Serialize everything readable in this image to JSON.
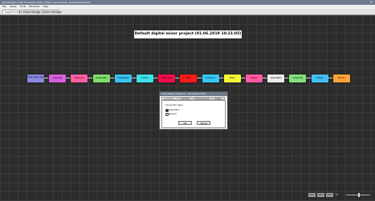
{
  "window": {
    "title": "Distributed Audio Processor Suite - Mixer Core Version 10 (Release Build)",
    "close": "✕"
  },
  "menu": [
    "File",
    "Setup",
    "Tools",
    "Windows",
    "Help"
  ],
  "tabs": [
    {
      "label": "Layout Control",
      "active": true
    },
    {
      "label": "Preset Manager",
      "active": false
    },
    {
      "label": "System Manager",
      "active": false
    }
  ],
  "project_title": "Default digital mixer project (01.06.2019 10:21:05)",
  "nodes": [
    {
      "label": "Input / Gain Adjust",
      "color": "#8a8adf"
    },
    {
      "label": "Insert EQ",
      "color": "#d65fe0"
    },
    {
      "label": "Dynamics",
      "color": "#ff5fa0"
    },
    {
      "label": "Noise Gate",
      "color": "#7ddd6d"
    },
    {
      "label": "Compressor",
      "color": "#39c2ef"
    },
    {
      "label": "Limiter",
      "color": "#3fe0e6"
    },
    {
      "label": "Delay Line",
      "color": "#f40d4d"
    },
    {
      "label": "Mute",
      "color": "#ff1a1a"
    },
    {
      "label": "Crossover",
      "color": "#38c6f6"
    },
    {
      "label": "Mixer",
      "color": "#f3f536"
    },
    {
      "label": "Router",
      "color": "#ff5aa2"
    },
    {
      "label": "Level Meter",
      "color": "#eaeaea"
    },
    {
      "label": "Output EQ",
      "color": "#82e07e"
    },
    {
      "label": "Output",
      "color": "#3fbff0"
    },
    {
      "label": "Monitor",
      "color": "#ffa33a"
    }
  ],
  "dialog": {
    "title": "Cross Check / Selection - Connection Mode",
    "tabs": [
      "Connection",
      "Input Type",
      "Channel Source",
      "Display"
    ],
    "heading": "Connection Type",
    "options": [
      {
        "label": "Automatic",
        "selected": true
      },
      {
        "label": "Manual",
        "selected": false
      }
    ],
    "ok_label": "OK",
    "cancel_label": "Cancel"
  },
  "zoom": {
    "buttons": [
      "100%",
      "150%",
      "200%"
    ],
    "label": "Fit"
  }
}
